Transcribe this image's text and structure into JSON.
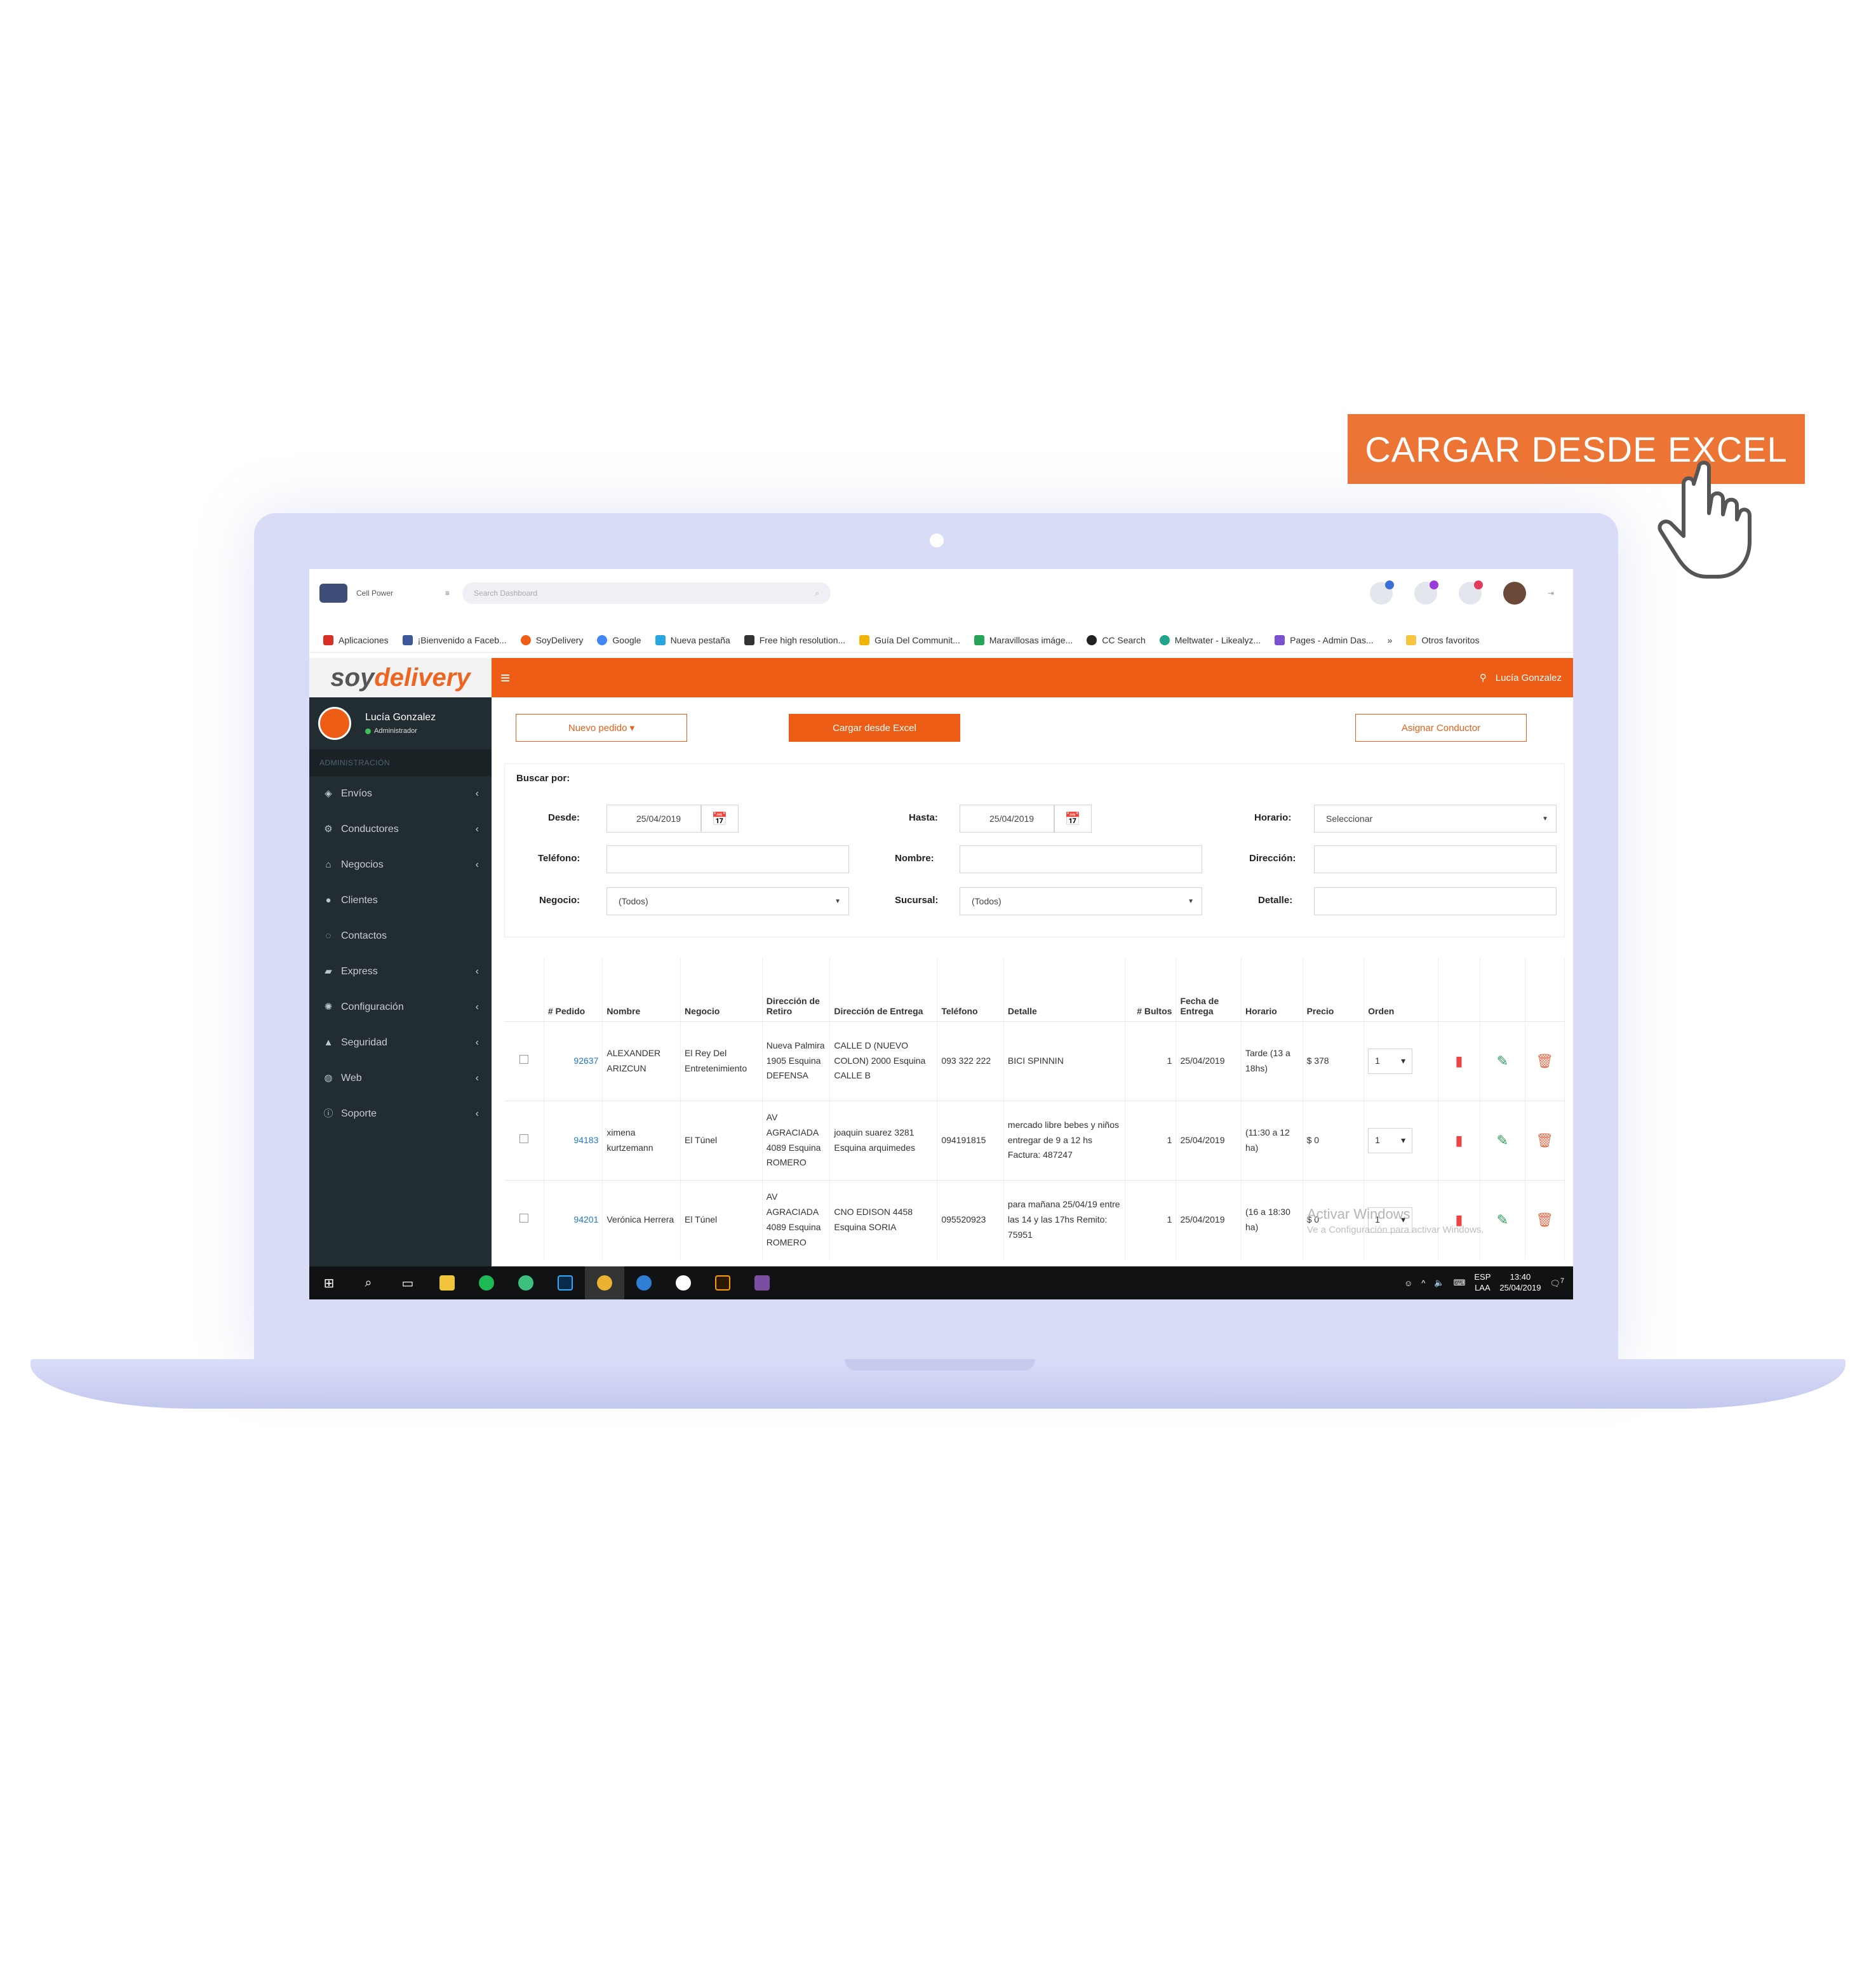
{
  "cta": {
    "label": "CARGAR DESDE EXCEL"
  },
  "browser": {
    "app_title": "Cell Power",
    "search_placeholder": "Search Dashboard",
    "bookmarks": [
      "Aplicaciones",
      "¡Bienvenido a Faceb...",
      "SoyDelivery",
      "Google",
      "Nueva pestaña",
      "Free high resolution...",
      "Guía Del Communit...",
      "Maravillosas imáge...",
      "CC Search",
      "Meltwater - Likealyz...",
      "Pages - Admin Das...",
      "»",
      "Otros favoritos"
    ]
  },
  "app": {
    "brand_soy": "soy",
    "brand_delivery": "delivery",
    "user_name": "Lucía Gonzalez",
    "user_role": "Administrador",
    "menu_toggle": "≡"
  },
  "sidebar": {
    "section": "ADMINISTRACIÓN",
    "items": [
      {
        "label": "Envíos",
        "icon": "cube-icon",
        "arrow": true
      },
      {
        "label": "Conductores",
        "icon": "motorbike-icon",
        "arrow": true
      },
      {
        "label": "Negocios",
        "icon": "bank-icon",
        "arrow": true
      },
      {
        "label": "Clientes",
        "icon": "user-icon",
        "arrow": false
      },
      {
        "label": "Contactos",
        "icon": "chat-icon",
        "arrow": false
      },
      {
        "label": "Express",
        "icon": "truck-icon",
        "arrow": true
      },
      {
        "label": "Configuración",
        "icon": "gear-icon",
        "arrow": true
      },
      {
        "label": "Seguridad",
        "icon": "lock-icon",
        "arrow": true
      },
      {
        "label": "Web",
        "icon": "globe-icon",
        "arrow": true
      },
      {
        "label": "Soporte",
        "icon": "info-icon",
        "arrow": true
      }
    ]
  },
  "actions": {
    "nuevo_pedido": "Nuevo pedido ▾",
    "cargar_excel": "Cargar desde Excel",
    "asignar_conductor": "Asignar Conductor"
  },
  "filters": {
    "buscar_por": "Buscar por:",
    "desde_label": "Desde:",
    "desde_value": "25/04/2019",
    "hasta_label": "Hasta:",
    "hasta_value": "25/04/2019",
    "horario_label": "Horario:",
    "horario_value": "Seleccionar",
    "telefono_label": "Teléfono:",
    "nombre_label": "Nombre:",
    "direccion_label": "Dirección:",
    "negocio_label": "Negocio:",
    "negocio_value": "(Todos)",
    "sucursal_label": "Sucursal:",
    "sucursal_value": "(Todos)",
    "detalle_label": "Detalle:"
  },
  "table": {
    "headers": [
      "# Pedido",
      "Nombre",
      "Negocio",
      "Dirección de Retiro",
      "Dirección de Entrega",
      "Teléfono",
      "Detalle",
      "# Bultos",
      "Fecha de Entrega",
      "Horario",
      "Precio",
      "Orden"
    ],
    "rows": [
      {
        "pedido": "92637",
        "nombre": "ALEXANDER ARIZCUN",
        "negocio": "El Rey Del Entretenimiento",
        "retiro": "Nueva Palmira 1905 Esquina DEFENSA",
        "entrega": "CALLE D (NUEVO COLON) 2000 Esquina CALLE B",
        "telefono": "093 322 222",
        "detalle": "BICI SPINNIN",
        "bultos": "1",
        "fecha": "25/04/2019",
        "horario": "Tarde (13 a 18hs)",
        "precio": "$ 378",
        "orden": "1"
      },
      {
        "pedido": "94183",
        "nombre": "ximena kurtzemann",
        "negocio": "El Túnel",
        "retiro": "AV AGRACIADA 4089 Esquina ROMERO",
        "entrega": "joaquin suarez 3281 Esquina arquimedes",
        "telefono": "094191815",
        "detalle": "mercado libre bebes y niños entregar de 9 a 12 hs Factura: 487247",
        "bultos": "1",
        "fecha": "25/04/2019",
        "horario": "(11:30 a 12 ha)",
        "precio": "$ 0",
        "orden": "1"
      },
      {
        "pedido": "94201",
        "nombre": "Verónica Herrera",
        "negocio": "El Túnel",
        "retiro": "AV AGRACIADA 4089 Esquina ROMERO",
        "entrega": "CNO EDISON 4458 Esquina SORIA",
        "telefono": "095520923",
        "detalle": "para mañana 25/04/19 entre las 14 y las 17hs Remito: 75951",
        "bultos": "1",
        "fecha": "25/04/2019",
        "horario": "(16 a 18:30 ha)",
        "precio": "$ 0",
        "orden": "1"
      }
    ]
  },
  "watermark": {
    "line1": "Activar Windows",
    "line2": "Ve a Configuración para activar Windows."
  },
  "taskbar": {
    "lang": "ESP",
    "lang2": "LAA",
    "time": "13:40",
    "date": "25/04/2019",
    "notif": "7"
  },
  "colors": {
    "brand_orange": "#ee5d16",
    "cta_orange": "#ec7434",
    "sidebar_dark": "#222d32",
    "laptop_lilac": "#d8dcf7",
    "link_blue": "#1e7ac7"
  }
}
